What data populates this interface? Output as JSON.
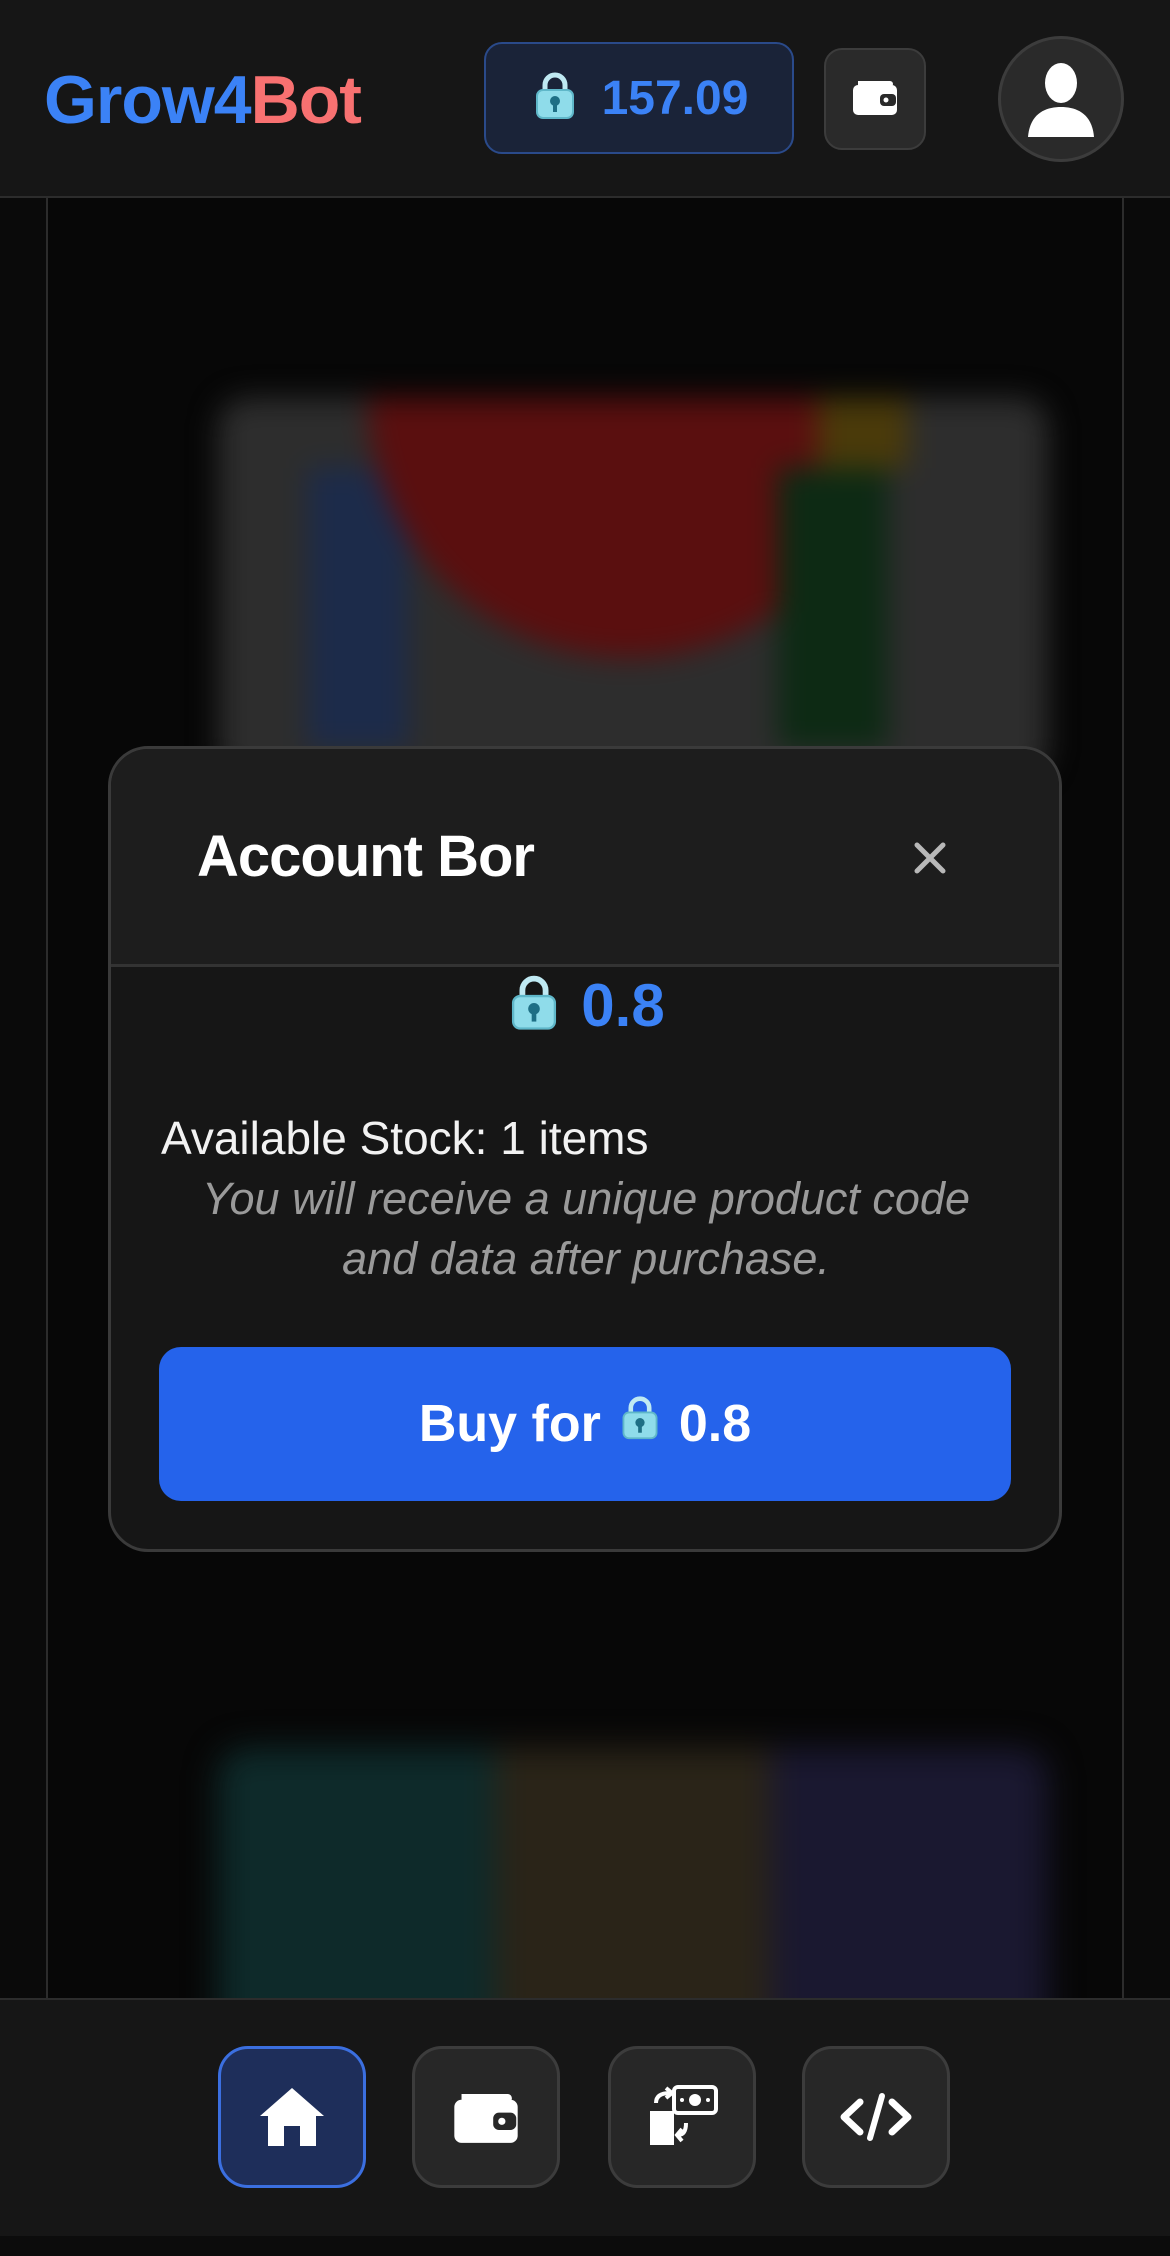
{
  "header": {
    "brand_part1": "Grow4",
    "brand_part2": "Bot",
    "balance": "157.09"
  },
  "modal": {
    "title": "Account Bor",
    "price": "0.8",
    "stock_text": "Available Stock: 1 items",
    "note": "You will receive a unique product code and data after purchase.",
    "buy_label": "Buy for",
    "buy_price": "0.8"
  },
  "colors": {
    "accent": "#3b82f6",
    "brand_red": "#f87171",
    "button": "#2563eb"
  },
  "bottom_nav": {
    "items": [
      "home-icon",
      "wallet-icon",
      "exchange-icon",
      "code-icon"
    ],
    "active": "home-icon"
  }
}
